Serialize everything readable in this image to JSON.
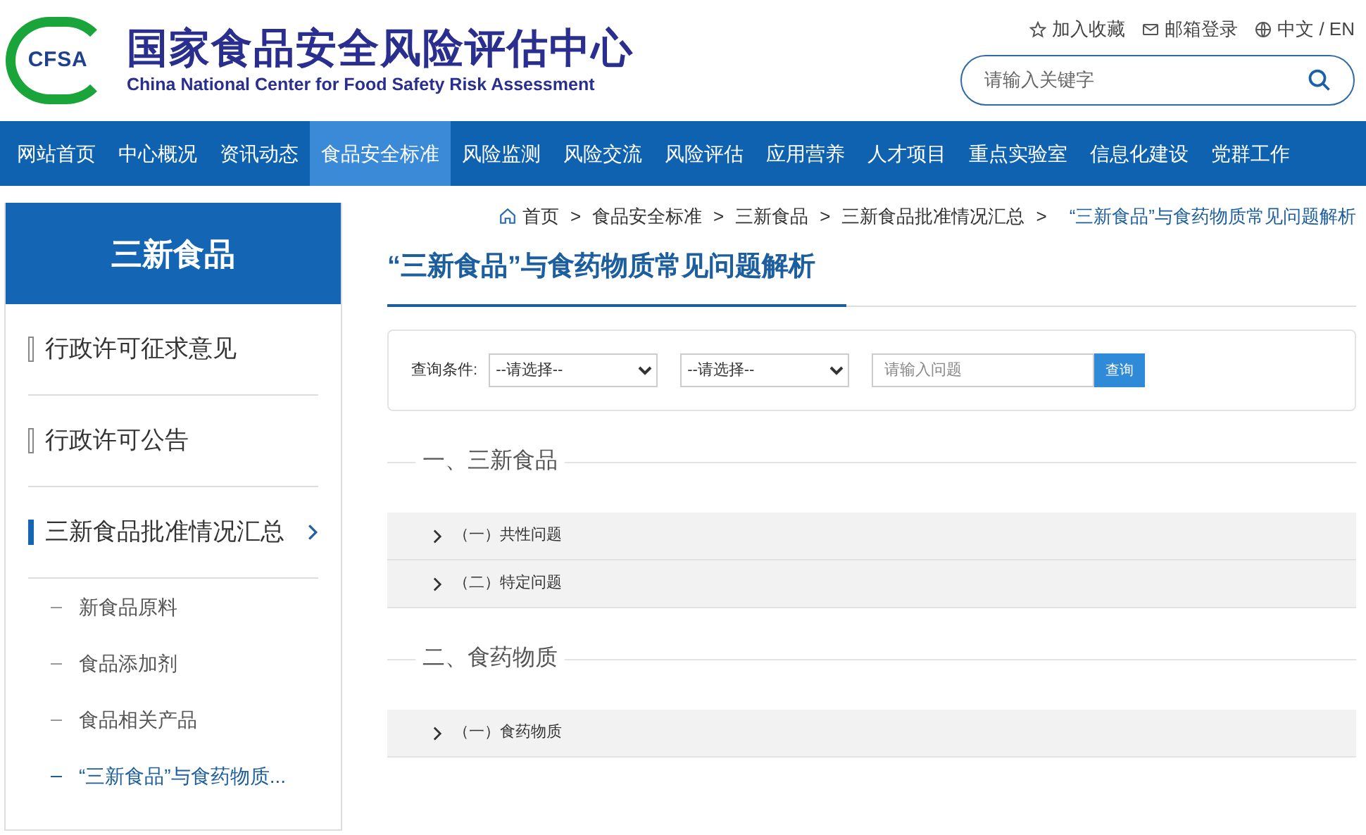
{
  "header": {
    "logo_text": "CFSA",
    "title": "国家食品安全风险评估中心",
    "subtitle": "China National Center for Food Safety Risk Assessment",
    "top_links": [
      {
        "kind": "favorite",
        "label": "加入收藏"
      },
      {
        "kind": "mail",
        "label": "邮箱登录"
      },
      {
        "kind": "language",
        "label": "中文 / EN"
      }
    ],
    "search": {
      "placeholder": "请输入关键字"
    }
  },
  "nav": [
    {
      "label": "网站首页",
      "selected": false
    },
    {
      "label": "中心概况",
      "selected": false
    },
    {
      "label": "资讯动态",
      "selected": false
    },
    {
      "label": "食品安全标准",
      "selected": true
    },
    {
      "label": "风险监测",
      "selected": false
    },
    {
      "label": "风险交流",
      "selected": false
    },
    {
      "label": "风险评估",
      "selected": false
    },
    {
      "label": "应用营养",
      "selected": false
    },
    {
      "label": "人才项目",
      "selected": false
    },
    {
      "label": "重点实验室",
      "selected": false
    },
    {
      "label": "信息化建设",
      "selected": false
    },
    {
      "label": "党群工作",
      "selected": false
    }
  ],
  "sidebar": {
    "title": "三新食品",
    "items": [
      {
        "label": "行政许可征求意见",
        "selected": false
      },
      {
        "label": "行政许可公告",
        "selected": false
      },
      {
        "label": "三新食品批准情况汇总",
        "selected": true,
        "children": [
          {
            "label": "新食品原料",
            "selected": false
          },
          {
            "label": "食品添加剂",
            "selected": false
          },
          {
            "label": "食品相关产品",
            "selected": false
          },
          {
            "label": "“三新食品”与食药物质...",
            "selected": true
          }
        ]
      }
    ]
  },
  "breadcrumb": [
    {
      "label": "首页",
      "selected": false
    },
    {
      "label": "食品安全标准",
      "selected": false
    },
    {
      "label": "三新食品",
      "selected": false
    },
    {
      "label": "三新食品批准情况汇总",
      "selected": false
    },
    {
      "label": "“三新食品”与食药物质常见问题解析",
      "selected": true
    }
  ],
  "breadcrumb_separator": ">",
  "page_title": "“三新食品”与食药物质常见问题解析",
  "query": {
    "label": "查询条件:",
    "selects": [
      "--请选择--",
      "--请选择--"
    ],
    "placeholder": "请输入问题",
    "button": "查询"
  },
  "sections": [
    {
      "title": "一、三新食品",
      "items": [
        {
          "label": "（一）共性问题",
          "expanded": false
        },
        {
          "label": "（二）特定问题",
          "expanded": false
        }
      ]
    },
    {
      "title": "二、食药物质",
      "items": [
        {
          "label": "（一）食药物质",
          "expanded": false
        }
      ]
    }
  ]
}
